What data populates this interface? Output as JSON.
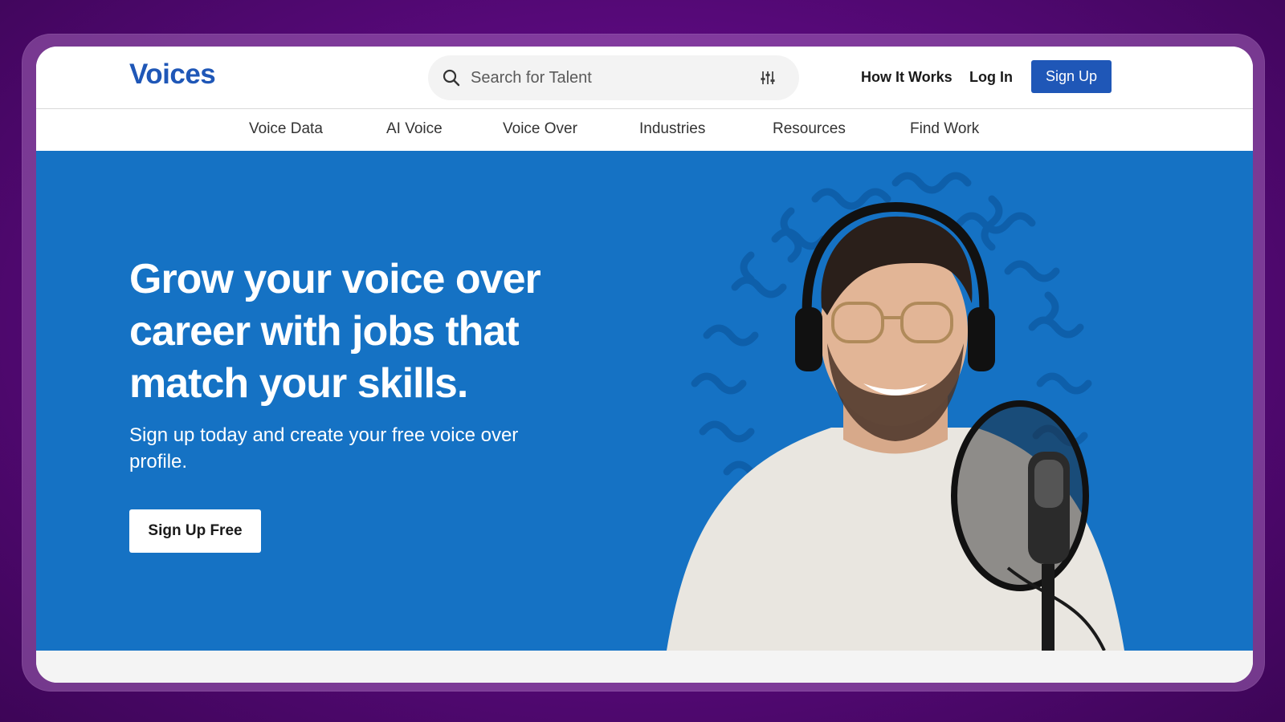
{
  "brand": {
    "logo": "Voices",
    "color": "#1f57b7"
  },
  "search": {
    "placeholder": "Search for Talent",
    "icon": "search-icon",
    "filter_icon": "sliders-icon"
  },
  "header": {
    "how_it_works": "How It Works",
    "log_in": "Log In",
    "sign_up": "Sign Up"
  },
  "subnav": {
    "items": [
      {
        "label": "Voice Data"
      },
      {
        "label": "AI Voice"
      },
      {
        "label": "Voice Over"
      },
      {
        "label": "Industries"
      },
      {
        "label": "Resources"
      },
      {
        "label": "Find Work"
      }
    ]
  },
  "hero": {
    "title": "Grow your voice over career with jobs that match your skills.",
    "subtitle": "Sign up today and create your free voice over profile.",
    "cta": "Sign Up Free",
    "background": "#1572c4"
  }
}
